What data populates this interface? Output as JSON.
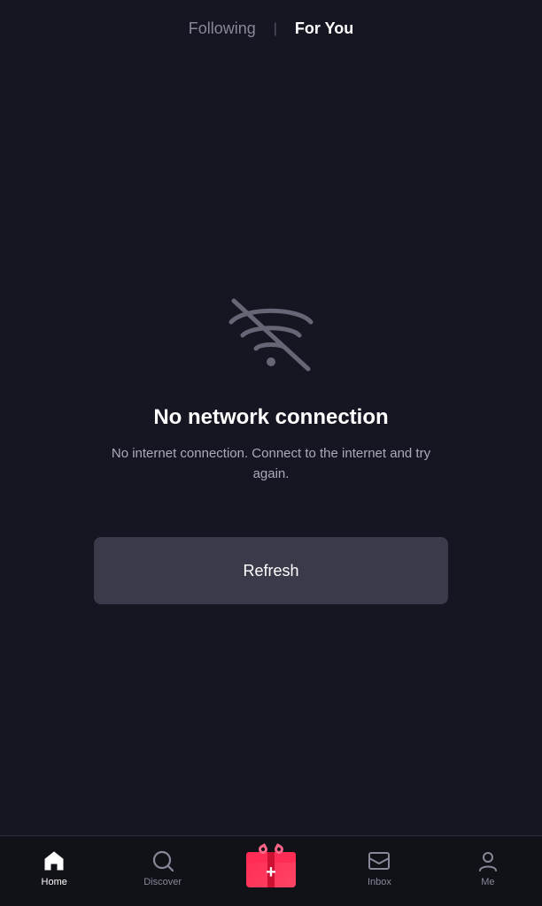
{
  "header": {
    "following_label": "Following",
    "divider": "|",
    "for_you_label": "For You"
  },
  "error": {
    "icon_label": "no-wifi-icon",
    "title": "No network connection",
    "description": "No internet connection. Connect to the internet and try again."
  },
  "refresh_button": {
    "label": "Refresh"
  },
  "bottom_nav": {
    "items": [
      {
        "id": "home",
        "label": "Home",
        "active": true
      },
      {
        "id": "discover",
        "label": "Discover",
        "active": false
      },
      {
        "id": "add",
        "label": "",
        "active": false
      },
      {
        "id": "inbox",
        "label": "Inbox",
        "active": false
      },
      {
        "id": "me",
        "label": "Me",
        "active": false
      }
    ]
  },
  "colors": {
    "background": "#161622",
    "header_active": "#ffffff",
    "header_inactive": "#888899",
    "error_title": "#ffffff",
    "error_desc": "#aaaabc",
    "refresh_bg": "#3a3a4a",
    "nav_bg": "#111118",
    "gift_color": "#ff2d55",
    "nav_active": "#ffffff",
    "nav_inactive": "#888899"
  }
}
